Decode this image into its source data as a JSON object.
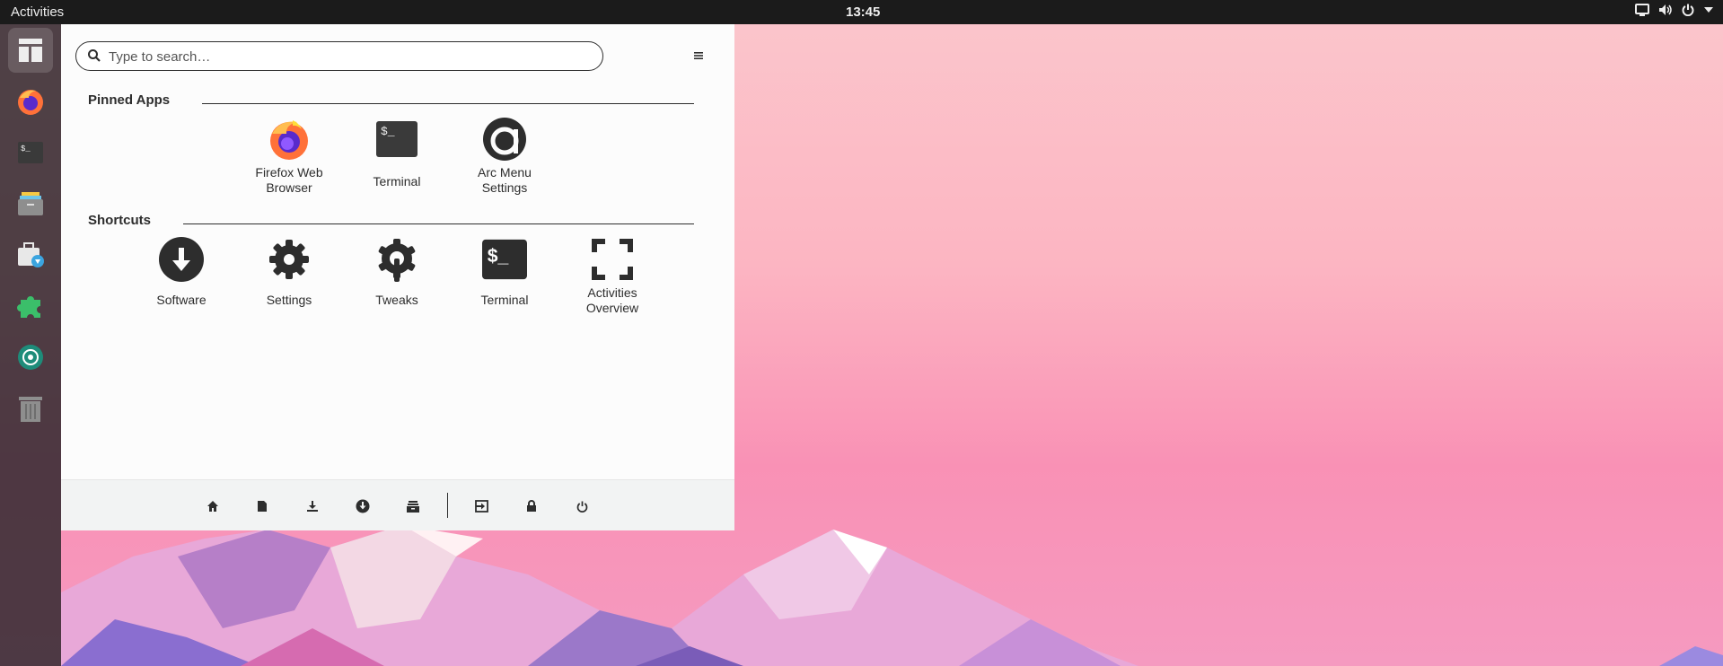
{
  "topbar": {
    "activities": "Activities",
    "clock": "13:45",
    "tray_icons": [
      "screen-icon",
      "volume-icon",
      "power-icon",
      "dropdown-arrow-icon"
    ]
  },
  "dock": {
    "items": [
      "arcmenu-icon",
      "firefox-icon",
      "terminal-icon",
      "files-icon",
      "software-icon",
      "extensions-icon",
      "camera-icon",
      "trash-icon"
    ]
  },
  "menu": {
    "search": {
      "placeholder": "Type to search…",
      "value": ""
    },
    "pinned": {
      "title": "Pinned Apps",
      "apps": [
        {
          "label1": "Firefox Web",
          "label2": "Browser",
          "icon": "firefox-icon"
        },
        {
          "label1": "Terminal",
          "label2": "",
          "icon": "terminal-icon"
        },
        {
          "label1": "Arc Menu",
          "label2": "Settings",
          "icon": "arc-menu-icon"
        }
      ]
    },
    "shortcuts": {
      "title": "Shortcuts",
      "items": [
        {
          "label1": "Software",
          "label2": "",
          "icon": "download-circle-icon"
        },
        {
          "label1": "Settings",
          "label2": "",
          "icon": "gear-icon"
        },
        {
          "label1": "Tweaks",
          "label2": "",
          "icon": "tweaks-icon"
        },
        {
          "label1": "Terminal",
          "label2": "",
          "icon": "terminal-icon"
        },
        {
          "label1": "Activities",
          "label2": "Overview",
          "icon": "fullscreen-icon"
        }
      ]
    },
    "footer_icons": [
      "home-icon",
      "document-icon",
      "download-icon",
      "software-icon",
      "files-icon",
      "logout-icon",
      "lock-icon",
      "power-icon"
    ],
    "colors": {
      "panel": "#fcfcfc",
      "footer": "#f2f3f3",
      "text": "#2d2d2d",
      "topbar": "#1b1b1b"
    }
  }
}
